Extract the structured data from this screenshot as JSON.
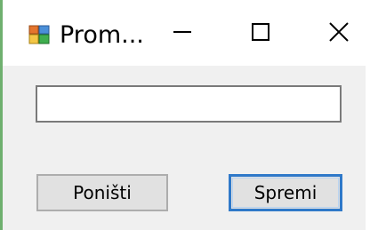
{
  "window": {
    "title": "Prom..."
  },
  "titlebar": {
    "icons": {
      "app": "application-icon",
      "minimize": "minimize-icon",
      "maximize": "maximize-icon",
      "close": "close-icon"
    }
  },
  "form": {
    "input_value": "",
    "cancel_label": "Poništi",
    "save_label": "Spremi"
  },
  "colors": {
    "focus_border": "#2f79c9",
    "client_background": "#f0f0f0",
    "button_background": "#e1e1e1"
  }
}
